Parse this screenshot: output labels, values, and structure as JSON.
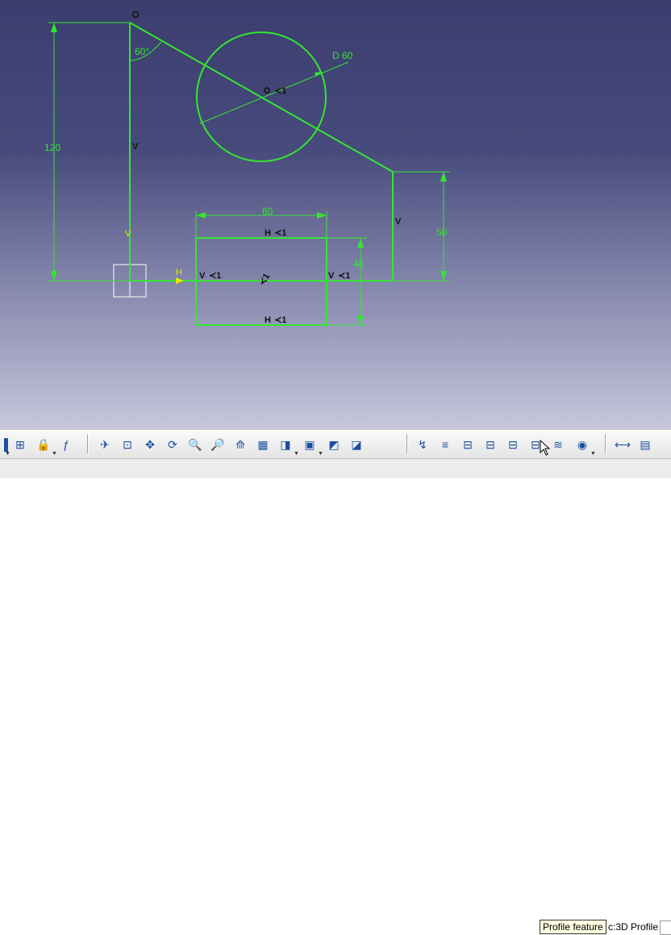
{
  "sketch": {
    "dimensions": {
      "angle": "60°",
      "diameter": "D 60",
      "height_total": "120",
      "rect_width": "60",
      "rect_height": "40",
      "right_height": "50"
    },
    "constraint_labels": {
      "vertical": "V",
      "horizontal": "H",
      "fix_symbol": "≺1"
    },
    "axis_labels": {
      "h_axis": "H",
      "v_axis": "V"
    }
  },
  "toolbar": {
    "icons": [
      "grid-icon",
      "analysis-icon",
      "lock-icon",
      "formula-icon",
      "fly-icon",
      "fit-all-icon",
      "pan-icon",
      "rotate-icon",
      "zoom-in-icon",
      "zoom-out-icon",
      "normal-view-icon",
      "multi-view-icon",
      "iso-view-icon",
      "shading-icon",
      "hide-show-icon",
      "swap-space-icon",
      "sketch-tools-icon",
      "constraint-icon",
      "profile-1-icon",
      "profile-2-icon",
      "profile-3-icon",
      "profile-feature-icon",
      "surface-icon",
      "analysis-tools-icon",
      "measure-icon",
      "pad-icon"
    ]
  },
  "status": {
    "tooltip": "Profile feature",
    "command_text": "c:3D Profile",
    "command_value": ""
  },
  "colors": {
    "sketch_green": "#33e633",
    "constraint_yellow": "#e6e600",
    "background_top": "#3b3d6e",
    "background_bottom": "#c7c7dc"
  }
}
